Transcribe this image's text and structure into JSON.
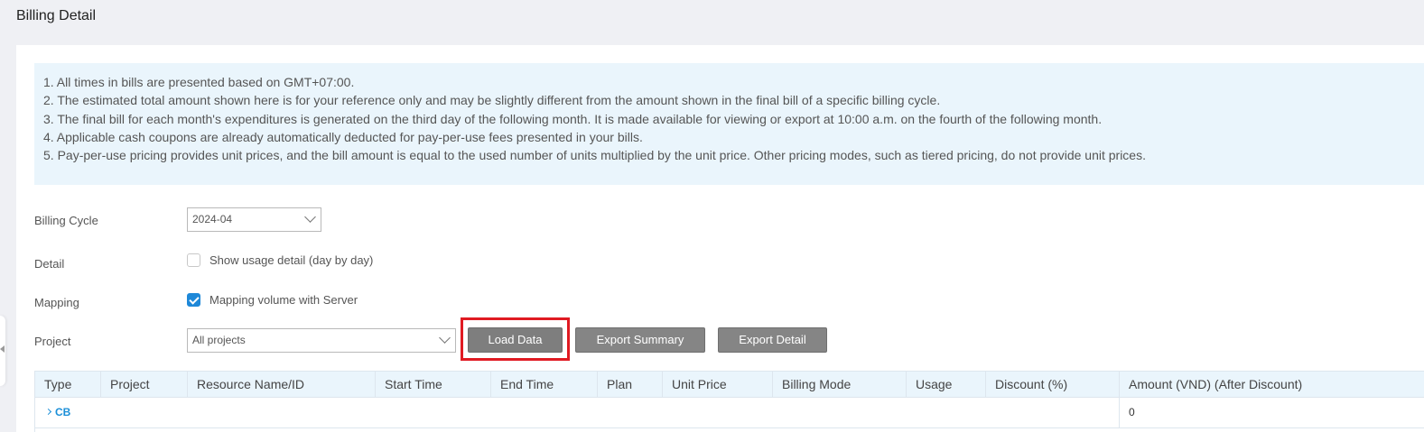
{
  "page": {
    "title": "Billing Detail"
  },
  "notice": {
    "lines": [
      "1. All times in bills are presented based on GMT+07:00.",
      "2. The estimated total amount shown here is for your reference only and may be slightly different from the amount shown in the final bill of a specific billing cycle.",
      "3. The final bill for each month's expenditures is generated on the third day of the following month. It is made available for viewing or export at 10:00 a.m. on the fourth of the following month.",
      "4. Applicable cash coupons are already automatically deducted for pay-per-use fees presented in your bills.",
      "5. Pay-per-use pricing provides unit prices, and the bill amount is equal to the used number of units multiplied by the unit price. Other pricing modes, such as tiered pricing, do not provide unit prices."
    ]
  },
  "form": {
    "billing_cycle": {
      "label": "Billing Cycle",
      "value": "2024-04"
    },
    "detail": {
      "label": "Detail",
      "checkbox_label": "Show usage detail (day by day)",
      "checked": false
    },
    "mapping": {
      "label": "Mapping",
      "checkbox_label": "Mapping volume with Server",
      "checked": true
    },
    "project": {
      "label": "Project",
      "value": "All projects"
    }
  },
  "toolbar": {
    "load_label": "Load Data",
    "export_summary_label": "Export Summary",
    "export_detail_label": "Export Detail"
  },
  "table": {
    "columns": [
      "Type",
      "Project",
      "Resource Name/ID",
      "Start Time",
      "End Time",
      "Plan",
      "Unit Price",
      "Billing Mode",
      "Usage",
      "Discount (%)",
      "Amount (VND) (After Discount)"
    ],
    "rows": [
      {
        "type": "CB",
        "amount": "0"
      }
    ]
  },
  "colors": {
    "accent": "#1e88d8",
    "highlight": "#e01a22",
    "notice_bg": "#eaf5fc"
  }
}
